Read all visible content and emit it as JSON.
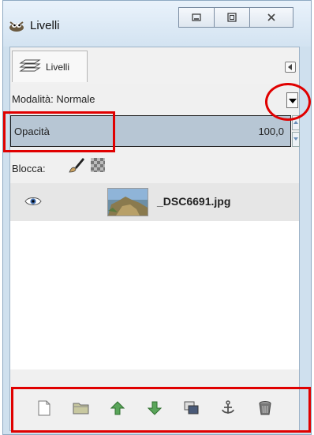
{
  "window": {
    "title": "Livelli",
    "app_icon": "gimp-wilber-icon"
  },
  "window_controls": {
    "minimize": "minimize-icon",
    "maximize": "maximize-icon",
    "close": "close-icon"
  },
  "tab": {
    "label": "Livelli",
    "icon": "layers-icon",
    "menu_icon": "tab-menu-icon"
  },
  "mode": {
    "label": "Modalità:",
    "value": "Normale"
  },
  "opacity": {
    "label": "Opacità",
    "value": "100,0"
  },
  "lock": {
    "label": "Blocca:",
    "icons": [
      "lock-pixels-brush-icon",
      "lock-alpha-checker-icon"
    ]
  },
  "layers": [
    {
      "name": "_DSC6691.jpg",
      "visible": true
    }
  ],
  "toolbar": {
    "buttons": [
      "new-layer-icon",
      "open-folder-icon",
      "raise-layer-icon",
      "lower-layer-icon",
      "duplicate-layer-icon",
      "anchor-layer-icon",
      "delete-layer-icon"
    ]
  },
  "colors": {
    "highlight": "#e00000",
    "opacity_fill": "#b7c6d4",
    "window_frame": "#cfe0ee"
  }
}
